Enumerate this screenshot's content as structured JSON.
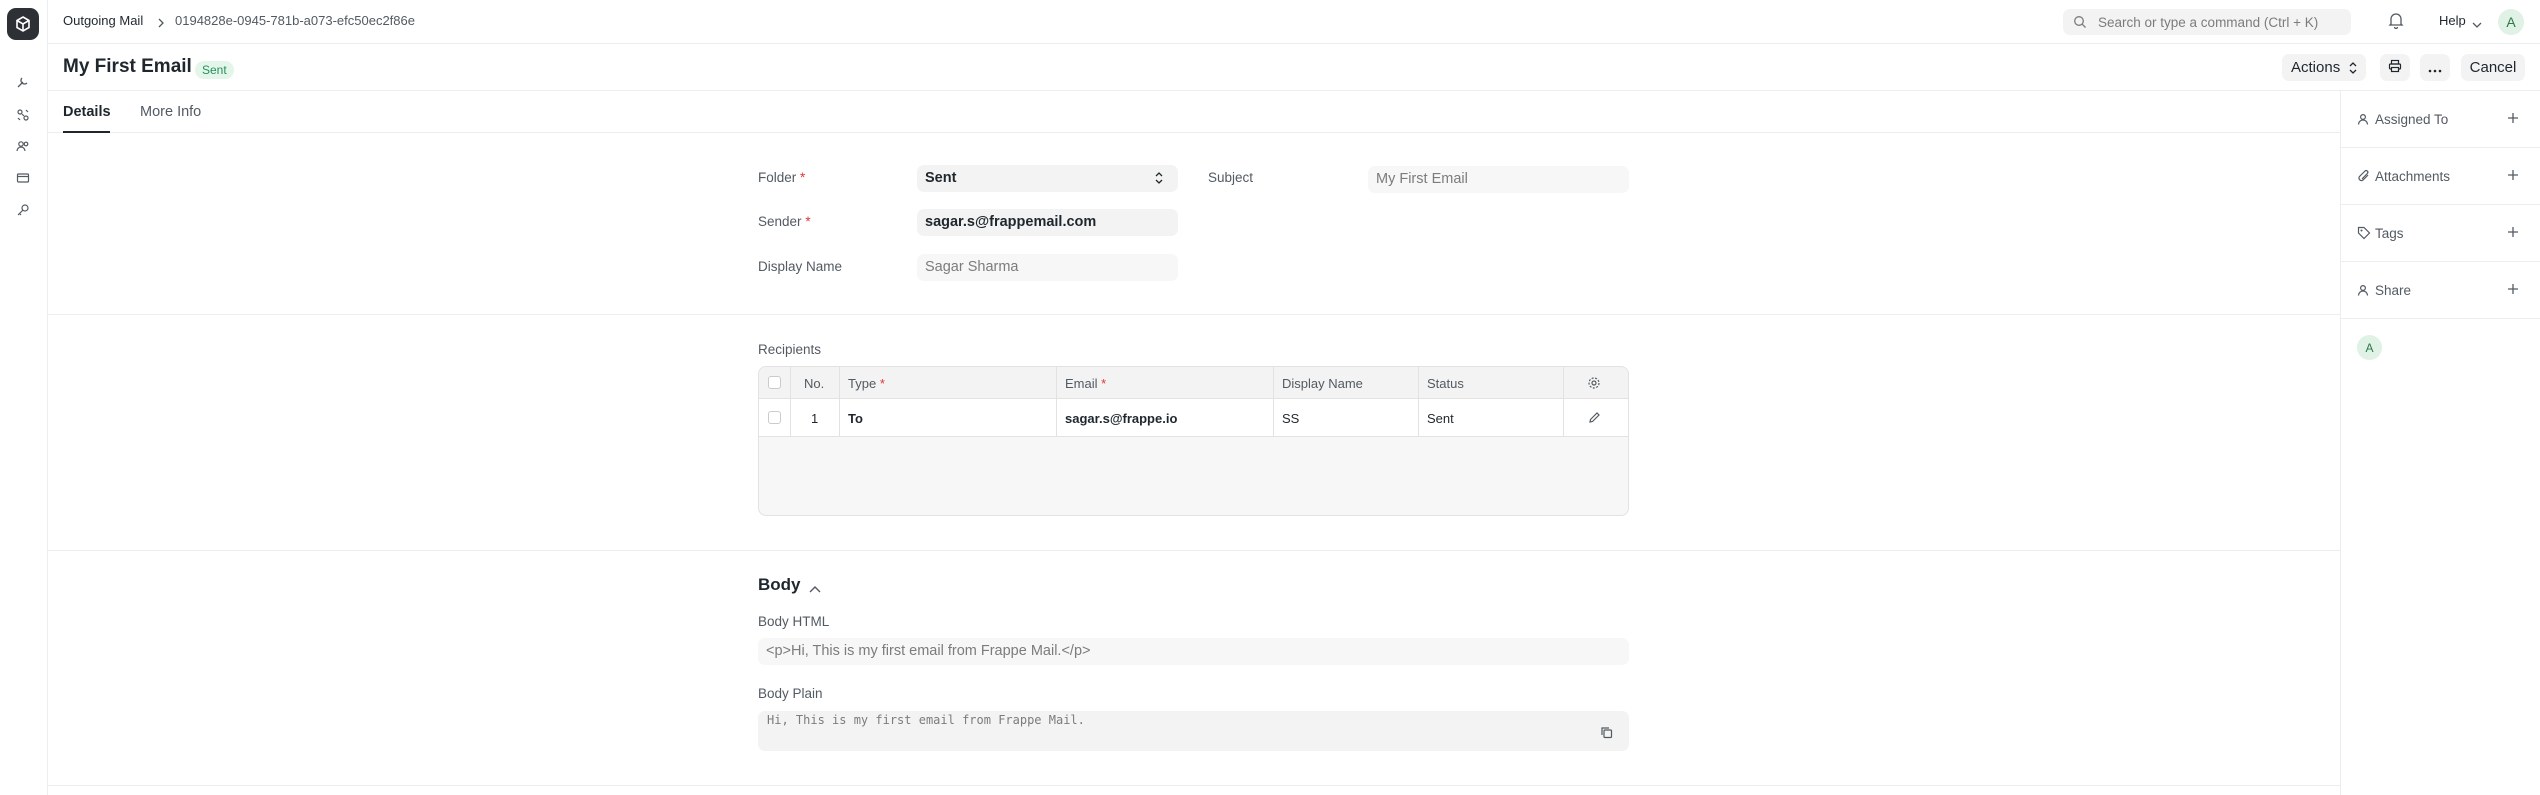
{
  "breadcrumb": {
    "module": "Outgoing Mail",
    "record_id": "0194828e-0945-781b-a073-efc50ec2f86e"
  },
  "topbar": {
    "search_placeholder": "Search or type a command (Ctrl + K)",
    "help_label": "Help",
    "avatar_initial": "A"
  },
  "header": {
    "title": "My First Email",
    "status_badge": "Sent",
    "actions_label": "Actions",
    "cancel_label": "Cancel"
  },
  "tabs": [
    {
      "label": "Details",
      "active": true
    },
    {
      "label": "More Info",
      "active": false
    }
  ],
  "form": {
    "folder": {
      "label": "Folder",
      "value": "Sent"
    },
    "subject": {
      "label": "Subject",
      "value": "My First Email"
    },
    "sender": {
      "label": "Sender",
      "value": "sagar.s@frappemail.com"
    },
    "display_name": {
      "label": "Display Name",
      "value": "Sagar Sharma"
    }
  },
  "recipients": {
    "label": "Recipients",
    "columns": {
      "no": "No.",
      "type": "Type",
      "email": "Email",
      "display_name": "Display Name",
      "status": "Status"
    },
    "rows": [
      {
        "no": "1",
        "type": "To",
        "email": "sagar.s@frappe.io",
        "display_name": "SS",
        "status": "Sent"
      }
    ]
  },
  "body": {
    "section_title": "Body",
    "body_html": {
      "label": "Body HTML",
      "value": "<p>Hi, This is my first email from Frappe Mail.</p>"
    },
    "body_plain": {
      "label": "Body Plain",
      "value": "Hi, This is my first email from Frappe Mail."
    }
  },
  "sidebar": {
    "items": [
      {
        "label": "Assigned To"
      },
      {
        "label": "Attachments"
      },
      {
        "label": "Tags"
      },
      {
        "label": "Share"
      }
    ],
    "viewer_initial": "A"
  },
  "colors": {
    "badge_bg": "#e4f5e9",
    "badge_text": "#278f5e",
    "required": "#e03636"
  }
}
